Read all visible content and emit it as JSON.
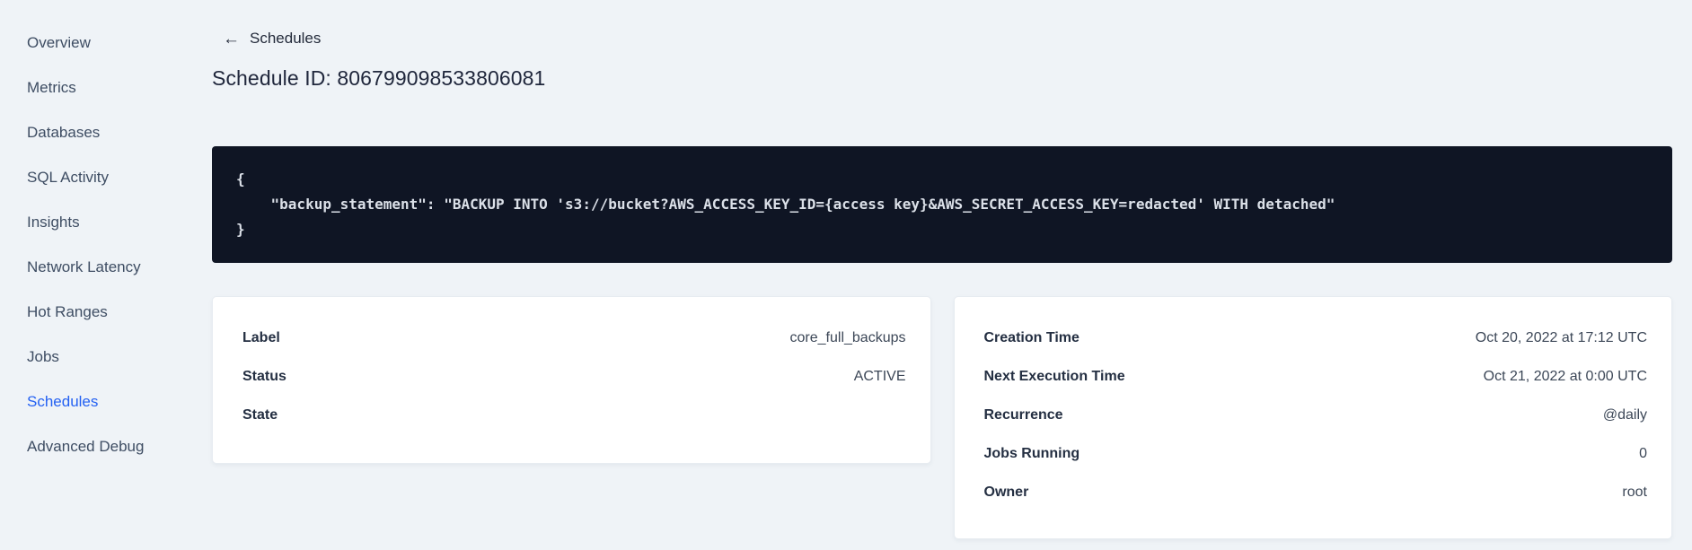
{
  "sidebar": {
    "items": [
      {
        "label": "Overview"
      },
      {
        "label": "Metrics"
      },
      {
        "label": "Databases"
      },
      {
        "label": "SQL Activity"
      },
      {
        "label": "Insights"
      },
      {
        "label": "Network Latency"
      },
      {
        "label": "Hot Ranges"
      },
      {
        "label": "Jobs"
      },
      {
        "label": "Schedules",
        "active": true
      },
      {
        "label": "Advanced Debug"
      }
    ]
  },
  "header": {
    "back_icon": "←",
    "back_label": "Schedules",
    "title": "Schedule ID: 806799098533806081"
  },
  "code_block": {
    "lines": [
      "{",
      "    \"backup_statement\": \"BACKUP INTO 's3://bucket?AWS_ACCESS_KEY_ID={access key}&AWS_SECRET_ACCESS_KEY=redacted' WITH detached\"",
      "}"
    ]
  },
  "details_card": {
    "rows": [
      {
        "label": "Label",
        "value": "core_full_backups"
      },
      {
        "label": "Status",
        "value": "ACTIVE"
      },
      {
        "label": "State",
        "value": ""
      }
    ]
  },
  "schedule_card": {
    "rows": [
      {
        "label": "Creation Time",
        "value": "Oct 20, 2022 at 17:12 UTC"
      },
      {
        "label": "Next Execution Time",
        "value": "Oct 21, 2022 at 0:00 UTC"
      },
      {
        "label": "Recurrence",
        "value": "@daily"
      },
      {
        "label": "Jobs Running",
        "value": "0"
      },
      {
        "label": "Owner",
        "value": "root"
      }
    ]
  },
  "colors": {
    "page_bg": "#eff3f7",
    "active_link": "#2461f2",
    "code_bg": "#0f1524",
    "code_text": "#dbe0e8",
    "card_bg": "#ffffff",
    "text_primary": "#242f42",
    "text_secondary": "#3e4d63"
  }
}
